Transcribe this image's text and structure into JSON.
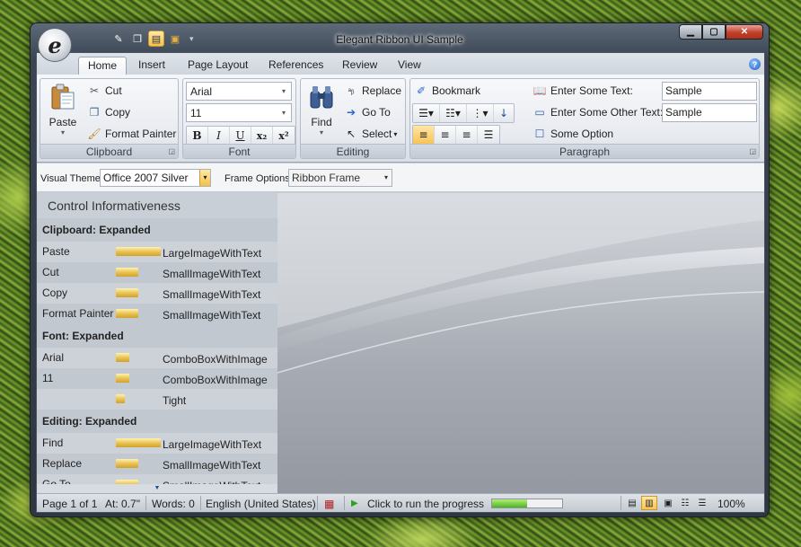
{
  "window": {
    "title": "Elegant Ribbon UI Sample",
    "app_button_glyph": "e"
  },
  "qat": [
    {
      "icon": "wand-icon",
      "glyph": "✎"
    },
    {
      "icon": "copy-pages-icon",
      "glyph": "❐"
    },
    {
      "icon": "page-icon",
      "glyph": "▤"
    },
    {
      "icon": "gift-icon",
      "glyph": "🎁"
    }
  ],
  "tabs": [
    "Home",
    "Insert",
    "Page Layout",
    "References",
    "Review",
    "View"
  ],
  "clipboard": {
    "label": "Clipboard",
    "paste": "Paste",
    "cut": "Cut",
    "copy": "Copy",
    "format_painter": "Format Painter"
  },
  "font": {
    "label": "Font",
    "family": "Arial",
    "size": "11",
    "bold": "B",
    "italic": "I",
    "underline": "U",
    "subscript": "x₂",
    "superscript": "x²"
  },
  "editing": {
    "label": "Editing",
    "find": "Find",
    "replace": "Replace",
    "go_to": "Go To",
    "select": "Select"
  },
  "paragraph": {
    "label": "Paragraph",
    "bookmark": "Bookmark",
    "enter_some_text": "Enter Some Text:",
    "enter_some_other_text": "Enter Some Other Text:",
    "some_option": "Some Option",
    "sample1": "Sample",
    "sample2": "Sample"
  },
  "options": {
    "visual_theme_label": "Visual Theme",
    "visual_theme_value": "Office 2007 Silver",
    "frame_options_label": "Frame Options",
    "frame_options_value": "Ribbon Frame"
  },
  "panel": {
    "title": "Control Informativeness",
    "sections": [
      {
        "header": "Clipboard: Expanded",
        "rows": [
          {
            "name": "Paste",
            "mode": "LargeImageWithText",
            "level": 1.0
          },
          {
            "name": "Cut",
            "mode": "SmallImageWithText",
            "level": 0.5
          },
          {
            "name": "Copy",
            "mode": "SmallImageWithText",
            "level": 0.5
          },
          {
            "name": "Format Painter",
            "mode": "SmallImageWithText",
            "level": 0.5
          }
        ]
      },
      {
        "header": "Font: Expanded",
        "rows": [
          {
            "name": "Arial",
            "mode": "ComboBoxWithImage",
            "level": 0.3
          },
          {
            "name": "11",
            "mode": "ComboBoxWithImage",
            "level": 0.3
          },
          {
            "name": "",
            "mode": "Tight",
            "level": 0.2
          }
        ]
      },
      {
        "header": "Editing: Expanded",
        "rows": [
          {
            "name": "Find",
            "mode": "LargeImageWithText",
            "level": 1.0
          },
          {
            "name": "Replace",
            "mode": "SmallImageWithText",
            "level": 0.5
          },
          {
            "name": "Go To",
            "mode": "SmallImageWithText",
            "level": 0.5
          }
        ]
      }
    ]
  },
  "status": {
    "page": "Page 1 of 1",
    "at": "At: 0.7\"",
    "words": "Words: 0",
    "language": "English (United States)",
    "run_progress": "Click to run the progress",
    "progress": 0.5,
    "zoom": "100%"
  },
  "colors": {
    "accent_yellow": "#f5c24a",
    "close_red": "#c0402a",
    "progress_green": "#4bb321"
  }
}
